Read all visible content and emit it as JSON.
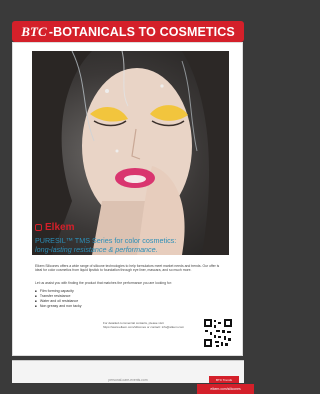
{
  "banner": {
    "logo": "BTC",
    "title": "-BOTANICALS TO COSMETICS"
  },
  "ad": {
    "brand": "Elkem",
    "headline": "PURESIL™ TMS Series for color cosmetics:",
    "subheadline": "long-lasting resistance & performance.",
    "intro": "Elkem Silicones offers a wide range of silicone technologies to help formulators meet market needs and trends. Our offer is ideal for color cosmetics from liquid lipstick to foundation through eye liner, mascara, and so much more.",
    "lead": "Let us assist you with finding the product that matches the performance you are looking for:",
    "bullets": [
      "Film forming capacity",
      "Transfer resistance",
      "Water and oil resistance",
      "Non greasy and non tacky"
    ],
    "contact": "For detailed commercial contacts, please visit https://www.elkem.com/silicones or contact: info@elkem.com",
    "tag_label": "elkem.com/silicones"
  },
  "next_page": {
    "footer": "personal-care-events.com",
    "tag_label": "BTC Trends"
  },
  "colors": {
    "accent_red": "#d4202a",
    "headline_blue": "#2c8fb8"
  }
}
